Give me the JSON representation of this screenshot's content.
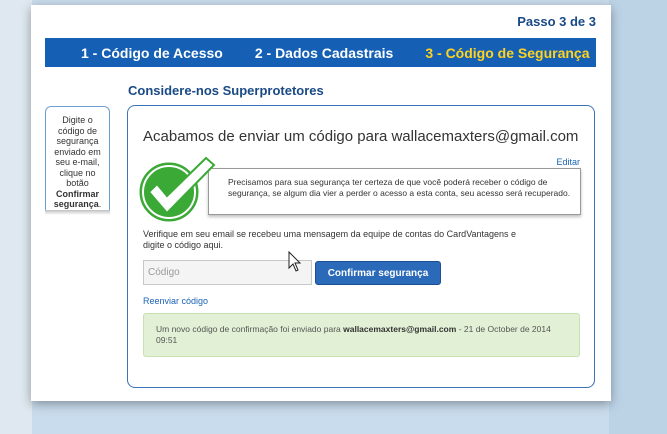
{
  "progress": {
    "counter": "Passo 3 de 3",
    "steps": [
      {
        "label": "1 - Código de Acesso",
        "active": false
      },
      {
        "label": "2 - Dados Cadastrais",
        "active": false
      },
      {
        "label": "3 - Código de Segurança",
        "active": true
      }
    ]
  },
  "section_title": "Considere-nos Superprotetores",
  "sidebar": {
    "text": "Digite o código de segurança enviado em seu e-mail, clique no botão",
    "strong": "Confirmar segurança",
    "suffix": "."
  },
  "card": {
    "heading": "Acabamos de enviar um código para wallacemaxters@gmail.com",
    "edit_label": "Editar",
    "info_text": "Precisamos para sua segurança ter certeza de que você poderá receber o código de segurança, se algum dia vier a perder o acesso a esta conta, seu acesso será recuperado.",
    "verify_text": "Verifique em seu email se recebeu uma mensagem da equipe de contas do CardVantagens e digite o código aqui.",
    "code_placeholder": "Código",
    "confirm_label": "Confirmar segurança",
    "resend_label": "Reenviar código",
    "success_prefix": "Um novo código de confirmação foi enviado para",
    "success_email": "wallacemaxters@gmail.com",
    "success_suffix": "- 21 de October de 2014 09:51"
  },
  "colors": {
    "nav_blue": "#1560b5",
    "active_step": "#ffd21f",
    "heading_blue": "#1a4a86",
    "check_green": "#3aa935",
    "success_bg": "#e2f0d6"
  },
  "icons": {
    "check": "check-circle-icon",
    "cursor": "mouse-cursor-icon"
  }
}
